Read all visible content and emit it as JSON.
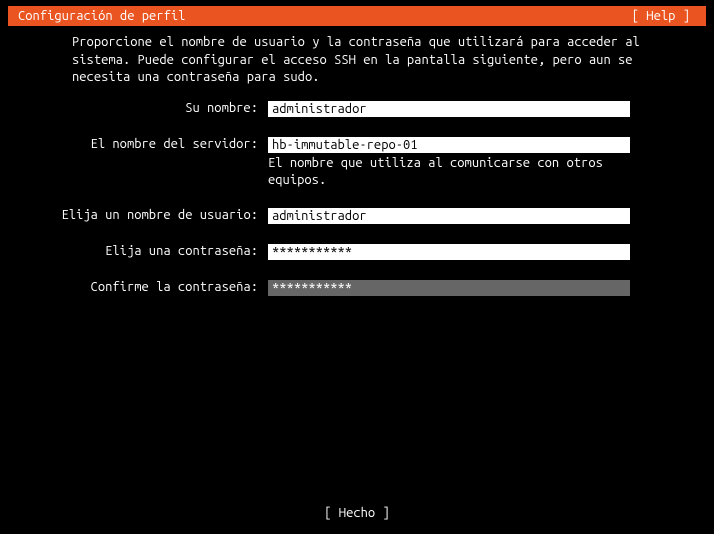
{
  "header": {
    "title": "Configuración de perfil",
    "help": "[ Help ]"
  },
  "intro": "Proporcione el nombre de usuario y la contraseña que utilizará para acceder al sistema. Puede configurar el acceso SSH en la pantalla siguiente, pero aun se necesita una contraseña para sudo.",
  "form": {
    "name": {
      "label": "Su nombre:",
      "value": "administrador"
    },
    "servername": {
      "label": "El nombre del servidor:",
      "value": "hb-immutable-repo-01",
      "hint": "El nombre que utiliza al comunicarse con otros equipos."
    },
    "username": {
      "label": "Elija un nombre de usuario:",
      "value": "administrador"
    },
    "password": {
      "label": "Elija una contraseña:",
      "value": "***********"
    },
    "confirm": {
      "label": "Confirme la contraseña:",
      "value": "***********"
    }
  },
  "footer": {
    "done": "[ Hecho     ]"
  }
}
